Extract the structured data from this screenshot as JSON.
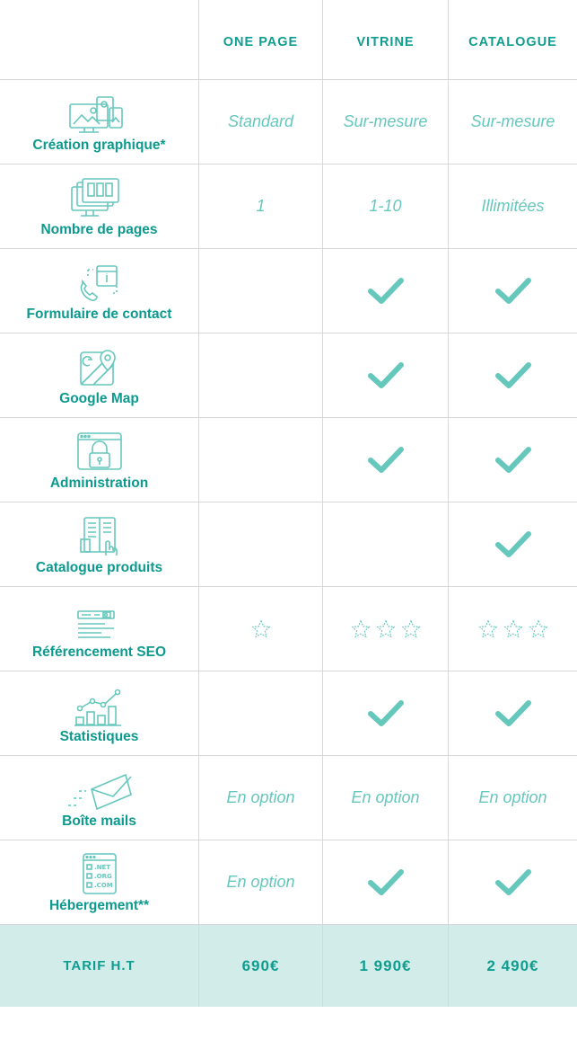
{
  "colors": {
    "accent": "#0f9d8f",
    "light": "#66c7bd",
    "price_bg": "#d2ecea"
  },
  "headers": [
    "ONE PAGE",
    "VITRINE",
    "CATALOGUE"
  ],
  "rows": [
    {
      "label": "Création graphique*",
      "icon": "design-icon",
      "cells": [
        {
          "type": "text",
          "value": "Standard"
        },
        {
          "type": "text",
          "value": "Sur-mesure"
        },
        {
          "type": "text",
          "value": "Sur-mesure"
        }
      ]
    },
    {
      "label": "Nombre de pages",
      "icon": "pages-icon",
      "cells": [
        {
          "type": "text",
          "value": "1"
        },
        {
          "type": "text",
          "value": "1-10"
        },
        {
          "type": "text",
          "value": "Illimitées"
        }
      ]
    },
    {
      "label": "Formulaire de contact",
      "icon": "contact-form-icon",
      "cells": [
        {
          "type": "empty"
        },
        {
          "type": "check"
        },
        {
          "type": "check"
        }
      ]
    },
    {
      "label": "Google Map",
      "icon": "map-icon",
      "cells": [
        {
          "type": "empty"
        },
        {
          "type": "check"
        },
        {
          "type": "check"
        }
      ]
    },
    {
      "label": "Administration",
      "icon": "lock-icon",
      "cells": [
        {
          "type": "empty"
        },
        {
          "type": "check"
        },
        {
          "type": "check"
        }
      ]
    },
    {
      "label": "Catalogue produits",
      "icon": "catalog-icon",
      "cells": [
        {
          "type": "empty"
        },
        {
          "type": "empty"
        },
        {
          "type": "check"
        }
      ]
    },
    {
      "label": "Référencement SEO",
      "icon": "seo-icon",
      "cells": [
        {
          "type": "stars",
          "value": 1
        },
        {
          "type": "stars",
          "value": 3
        },
        {
          "type": "stars",
          "value": 3
        }
      ]
    },
    {
      "label": "Statistiques",
      "icon": "chart-icon",
      "cells": [
        {
          "type": "empty"
        },
        {
          "type": "check"
        },
        {
          "type": "check"
        }
      ]
    },
    {
      "label": "Boîte mails",
      "icon": "mail-icon",
      "cells": [
        {
          "type": "text",
          "value": "En option"
        },
        {
          "type": "text",
          "value": "En option"
        },
        {
          "type": "text",
          "value": "En option"
        }
      ]
    },
    {
      "label": "Hébergement**",
      "icon": "hosting-icon",
      "cells": [
        {
          "type": "text",
          "value": "En option"
        },
        {
          "type": "check"
        },
        {
          "type": "check"
        }
      ]
    }
  ],
  "price": {
    "label": "TARIF H.T",
    "values": [
      "690€",
      "1 990€",
      "2 490€"
    ]
  }
}
